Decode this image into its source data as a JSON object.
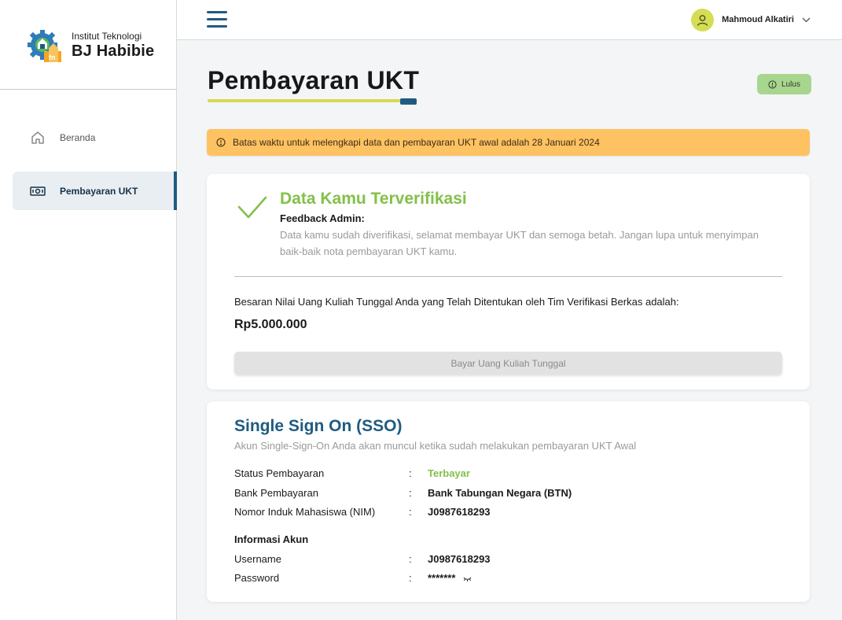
{
  "brand": {
    "line1": "Institut Teknologi",
    "line2": "BJ Habibie",
    "colors": {
      "primary": "#1f5b80",
      "accent_yellow": "#d6d957",
      "success": "#83c04a",
      "warning": "#fec263"
    }
  },
  "sidebar": {
    "items": [
      {
        "label": "Beranda",
        "icon": "home-icon",
        "active": false
      },
      {
        "label": "Pembayaran UKT",
        "icon": "money-icon",
        "active": true
      }
    ]
  },
  "header": {
    "menu_icon": "hamburger-icon",
    "user_name": "Mahmoud Alkatiri",
    "user_icon": "user-avatar-icon",
    "dropdown_icon": "chevron-down-icon"
  },
  "page": {
    "title": "Pembayaran UKT",
    "status_badge": "Lulus"
  },
  "alert": {
    "text": "Batas waktu untuk melengkapi data dan pembayaran UKT awal adalah 28 Januari 2024"
  },
  "verification": {
    "title": "Data Kamu Terverifikasi",
    "feedback_label": "Feedback Admin:",
    "feedback_text": "Data kamu sudah diverifikasi, selamat membayar UKT dan semoga betah. Jangan lupa untuk menyimpan baik-baik nota pembayaran UKT kamu.",
    "nominal_label": "Besaran Nilai Uang Kuliah Tunggal Anda  yang Telah Ditentukan oleh Tim Verifikasi Berkas adalah:",
    "nominal_value": "Rp5.000.000",
    "pay_button": "Bayar Uang Kuliah Tunggal"
  },
  "sso": {
    "title": "Single Sign On (SSO)",
    "subtitle": "Akun Single-Sign-On Anda akan muncul ketika sudah melakukan pembayaran UKT Awal",
    "separator": ":",
    "rows": [
      {
        "label": "Status Pembayaran",
        "value": "Terbayar"
      },
      {
        "label": "Bank Pembayaran",
        "value": "Bank Tabungan Negara (BTN)"
      },
      {
        "label": "Nomor Induk Mahasiswa (NIM)",
        "value": "J0987618293"
      }
    ],
    "account_heading": "Informasi Akun",
    "account_rows": [
      {
        "label": "Username",
        "value": "J0987618293"
      },
      {
        "label": "Password",
        "value": "*******"
      }
    ],
    "password_toggle_icon": "eye-closed-icon"
  }
}
